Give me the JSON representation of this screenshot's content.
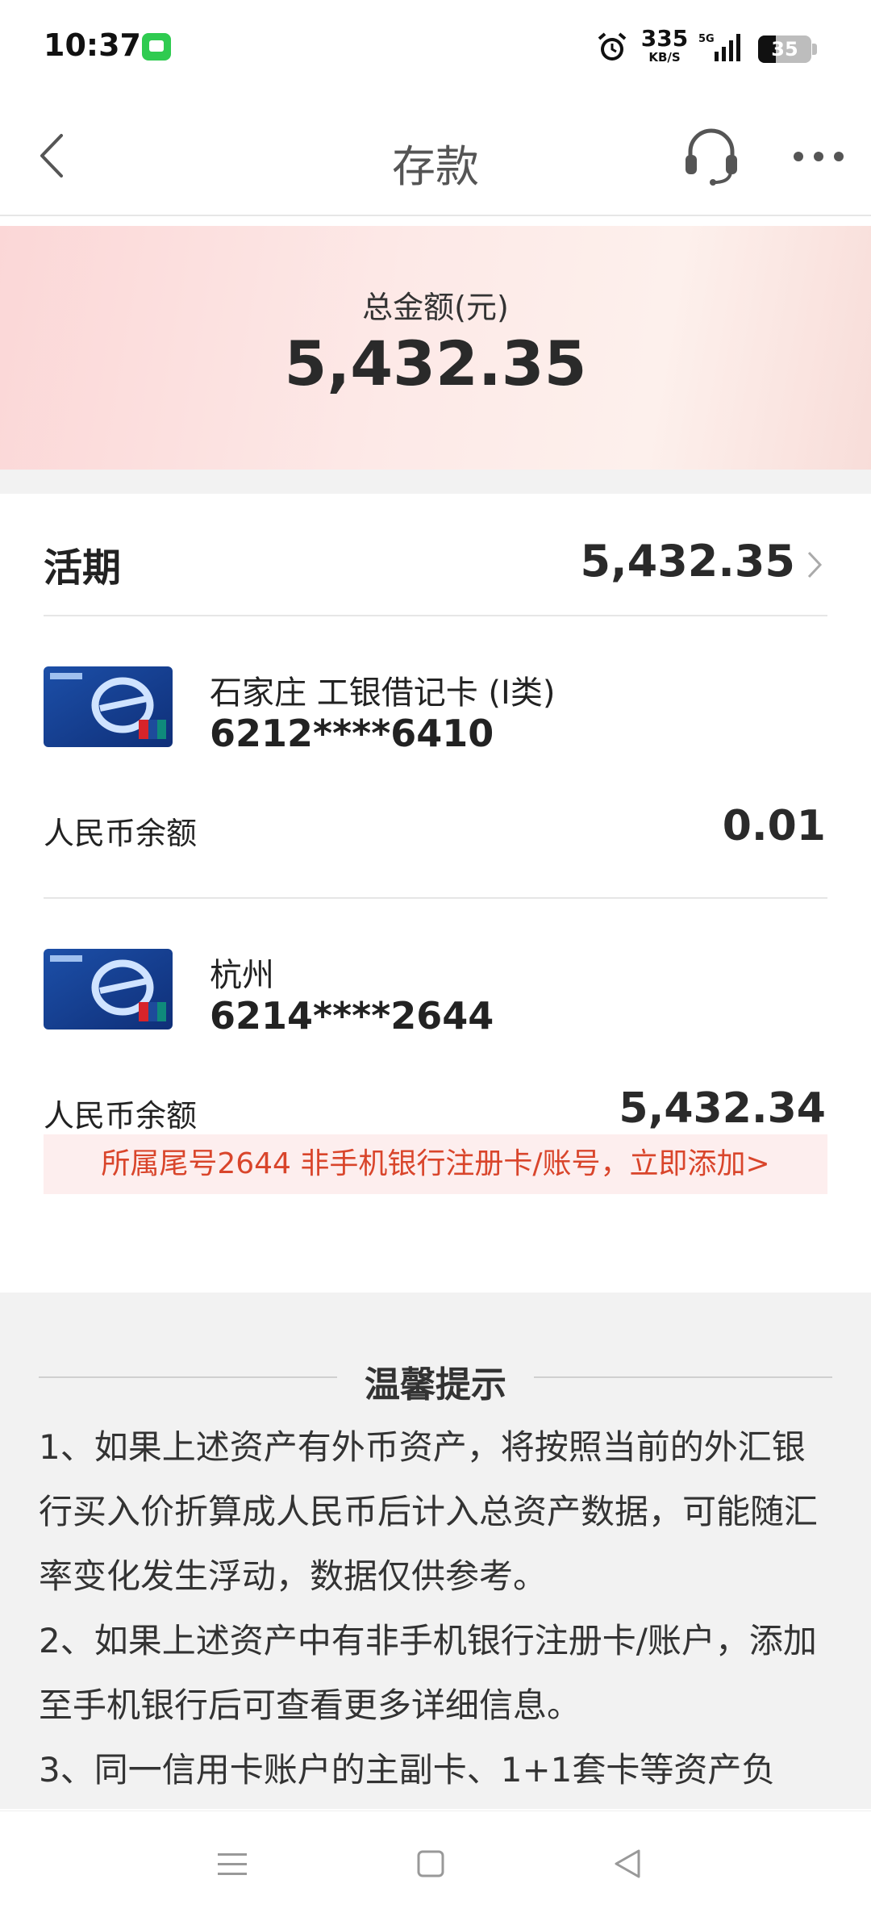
{
  "status_bar": {
    "time": "10:37",
    "net_speed_value": "335",
    "net_speed_unit": "KB/S",
    "network": "5G",
    "battery": "35"
  },
  "nav": {
    "title": "存款"
  },
  "summary": {
    "total_label": "总金额(元)",
    "total_amount": "5,432.35"
  },
  "current_deposit": {
    "title": "活期",
    "amount": "5,432.35"
  },
  "accounts": [
    {
      "name": "石家庄 工银借记卡 (I类)",
      "number": "6212****6410",
      "balance_label": "人民币余额",
      "balance": "0.01"
    },
    {
      "name": "杭州",
      "number": "6214****2644",
      "balance_label": "人民币余额",
      "balance": "5,432.34",
      "add_tip": "所属尾号2644 非手机银行注册卡/账号，立即添加>"
    }
  ],
  "tips": {
    "title": "温馨提示",
    "items": [
      "1、如果上述资产有外币资产，将按照当前的外汇银行买入价折算成人民币后计入总资产数据，可能随汇率变化发生浮动，数据仅供参考。",
      "2、如果上述资产中有非手机银行注册卡/账户，添加至手机银行后可查看更多详细信息。",
      "3、同一信用卡账户的主副卡、1+1套卡等资产负"
    ]
  },
  "colors": {
    "accent_red": "#d9452b",
    "tip_background": "#fdeeee"
  }
}
